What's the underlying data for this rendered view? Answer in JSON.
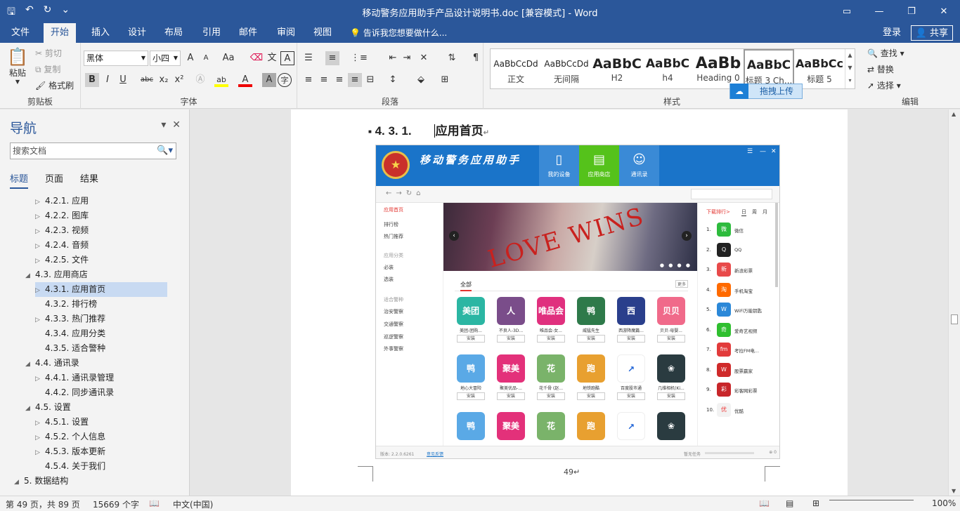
{
  "window": {
    "title": "移动警务应用助手产品设计说明书.doc [兼容模式] - Word",
    "quick_access": [
      "save-icon",
      "undo-icon",
      "redo-icon",
      "customize-icon"
    ],
    "controls": [
      "ribbon-display-icon",
      "minimize-icon",
      "restore-icon",
      "close-icon"
    ]
  },
  "tabs": [
    "文件",
    "开始",
    "插入",
    "设计",
    "布局",
    "引用",
    "邮件",
    "审阅",
    "视图"
  ],
  "active_tab": "开始",
  "tell_me": "告诉我您想要做什么...",
  "account": {
    "login": "登录",
    "share": "共享"
  },
  "ribbon": {
    "clipboard": {
      "label": "剪贴板",
      "paste": "粘贴",
      "cut": "剪切",
      "copy": "复制",
      "format_painter": "格式刷"
    },
    "font": {
      "label": "字体",
      "font_name": "黑体",
      "font_size": "小四",
      "change_case": "Aa",
      "bold": "B",
      "italic": "I",
      "underline": "U",
      "strike": "abc",
      "subscript": "x₂",
      "superscript": "x²",
      "highlight": "ab",
      "font_color": "A",
      "char_shade": "A",
      "enclose": "字",
      "wen": "文",
      "grow": "A",
      "shrink": "A"
    },
    "paragraph": {
      "label": "段落"
    },
    "styles": {
      "label": "样式",
      "items": [
        {
          "preview": "AaBbCcDd",
          "name": "正文"
        },
        {
          "preview": "AaBbCcDd",
          "name": "无间隔"
        },
        {
          "preview": "AaBbC",
          "name": "H2"
        },
        {
          "preview": "AaBbC",
          "name": "h4"
        },
        {
          "preview": "AaBb",
          "name": "Heading 0"
        },
        {
          "preview": "AaBbC",
          "name": "标题 3 Ch..."
        },
        {
          "preview": "AaBbCc",
          "name": "标题 5"
        }
      ],
      "upload": "拖拽上传"
    },
    "editing": {
      "label": "编辑",
      "find": "查找",
      "replace": "替换",
      "select": "选择"
    }
  },
  "nav": {
    "title": "导航",
    "search_placeholder": "搜索文档",
    "tabs": [
      "标题",
      "页面",
      "结果"
    ],
    "active_tab": "标题",
    "items": [
      {
        "label": "4.2.1. 应用",
        "expander": "collapsed",
        "selected": false
      },
      {
        "label": "4.2.2. 图库",
        "expander": "collapsed",
        "selected": false
      },
      {
        "label": "4.2.3. 视频",
        "expander": "collapsed",
        "selected": false
      },
      {
        "label": "4.2.4. 音频",
        "expander": "collapsed",
        "selected": false
      },
      {
        "label": "4.2.5. 文件",
        "expander": "collapsed",
        "selected": false
      },
      {
        "label": "4.3. 应用商店",
        "expander": "expanded",
        "selected": false
      },
      {
        "label": "4.3.1. 应用首页",
        "expander": "collapsed",
        "selected": true
      },
      {
        "label": "4.3.2. 排行榜",
        "expander": "none",
        "selected": false
      },
      {
        "label": "4.3.3. 热门推荐",
        "expander": "collapsed",
        "selected": false
      },
      {
        "label": "4.3.4. 应用分类",
        "expander": "none",
        "selected": false
      },
      {
        "label": "4.3.5. 适合警种",
        "expander": "none",
        "selected": false
      },
      {
        "label": "4.4. 通讯录",
        "expander": "expanded",
        "selected": false
      },
      {
        "label": "4.4.1. 通讯录管理",
        "expander": "collapsed",
        "selected": false
      },
      {
        "label": "4.4.2. 同步通讯录",
        "expander": "none",
        "selected": false
      },
      {
        "label": "4.5. 设置",
        "expander": "expanded",
        "selected": false
      },
      {
        "label": "4.5.1. 设置",
        "expander": "collapsed",
        "selected": false
      },
      {
        "label": "4.5.2. 个人信息",
        "expander": "collapsed",
        "selected": false
      },
      {
        "label": "4.5.3. 版本更新",
        "expander": "collapsed",
        "selected": false
      },
      {
        "label": "4.5.4. 关于我们",
        "expander": "none",
        "selected": false
      },
      {
        "label": "5. 数据结构",
        "expander": "expanded",
        "selected": false
      }
    ]
  },
  "doc": {
    "heading_number": "4. 3. 1.",
    "heading_text": "应用首页",
    "page_number": "49",
    "app": {
      "title": "移动警务应用助手",
      "header_tabs": [
        {
          "label": "我的设备",
          "icon": "device-icon",
          "color": "#3a8ad6"
        },
        {
          "label": "应用商店",
          "icon": "store-icon",
          "color": "#55c21b"
        },
        {
          "label": "通讯录",
          "icon": "contacts-icon",
          "color": "#3a8ad6"
        }
      ],
      "side_items": [
        {
          "label": "应用首页",
          "kind": "active"
        },
        {
          "label": "排行榜",
          "kind": "item"
        },
        {
          "label": "热门推荐",
          "kind": "item"
        },
        {
          "label": "应用分类",
          "kind": "cap"
        },
        {
          "label": "必装",
          "kind": "item"
        },
        {
          "label": "选装",
          "kind": "item"
        },
        {
          "label": "适合警种",
          "kind": "cap"
        },
        {
          "label": "治安警察",
          "kind": "item"
        },
        {
          "label": "交通警察",
          "kind": "item"
        },
        {
          "label": "巡逻警察",
          "kind": "item"
        },
        {
          "label": "外事警察",
          "kind": "item"
        }
      ],
      "banner_text": "LOVE WINS",
      "category": "全部",
      "more": "更多",
      "install": "安装",
      "apps_row1": [
        {
          "name": "美团-团购...",
          "glyph": "美团",
          "color": "#2bb6a3"
        },
        {
          "name": "不良人-3D...",
          "glyph": "人",
          "color": "#7a4d8a"
        },
        {
          "name": "唯品会-女...",
          "glyph": "唯品会",
          "color": "#e0307e"
        },
        {
          "name": "威猛先生",
          "glyph": "鸭",
          "color": "#2e7a4a"
        },
        {
          "name": "西游降魔篇...",
          "glyph": "西",
          "color": "#2a3f8c"
        },
        {
          "name": "贝贝-母婴...",
          "glyph": "贝贝",
          "color": "#f06a8a"
        }
      ],
      "apps_row2": [
        {
          "name": "地心大冒险",
          "glyph": "鸭",
          "color": "#5aa9e6"
        },
        {
          "name": "聚美优品-...",
          "glyph": "聚美",
          "color": "#e3317a"
        },
        {
          "name": "花千骨 (赵...",
          "glyph": "花",
          "color": "#7ab36a"
        },
        {
          "name": "地铁跑酷",
          "glyph": "跑",
          "color": "#e8a030"
        },
        {
          "name": "百度股市通",
          "glyph": "↗",
          "color": "#ffffff"
        },
        {
          "name": "几维相机(Ki...",
          "glyph": "❀",
          "color": "#2a3b40"
        }
      ],
      "apps_row3": [
        {
          "glyph": "鸭",
          "color": "#5aa9e6"
        },
        {
          "glyph": "聚美",
          "color": "#e3317a"
        },
        {
          "glyph": "花",
          "color": "#7ab36a"
        },
        {
          "glyph": "跑",
          "color": "#e8a030"
        },
        {
          "glyph": "↗",
          "color": "#ffffff"
        },
        {
          "glyph": "❀",
          "color": "#2a3b40"
        }
      ],
      "rank_header": "下载排行>",
      "rank_tabs": [
        "日",
        "周",
        "月"
      ],
      "rank": [
        {
          "no": "1.",
          "name": "微信",
          "glyph": "微",
          "color": "#2dbb3d"
        },
        {
          "no": "2.",
          "name": "QQ",
          "glyph": "Q",
          "color": "#222222"
        },
        {
          "no": "3.",
          "name": "新浪彩票",
          "glyph": "新",
          "color": "#e84a4a"
        },
        {
          "no": "4.",
          "name": "手机淘宝",
          "glyph": "淘",
          "color": "#ff6a00"
        },
        {
          "no": "5.",
          "name": "WiFi万能钥匙",
          "glyph": "W",
          "color": "#2b88d8"
        },
        {
          "no": "6.",
          "name": "爱奇艺视频",
          "glyph": "奇",
          "color": "#2fbf2f"
        },
        {
          "no": "7.",
          "name": "考拉FM电...",
          "glyph": "fm",
          "color": "#e23b3b"
        },
        {
          "no": "8.",
          "name": "股票赢家",
          "glyph": "W",
          "color": "#cf2a2a"
        },
        {
          "no": "9.",
          "name": "彩客网彩票",
          "glyph": "彩",
          "color": "#c8262a"
        },
        {
          "no": "10.",
          "name": "优酷",
          "glyph": "优",
          "color": "#f2f2f2"
        }
      ],
      "footer": {
        "version": "版本: 2.2.0.6261",
        "feedback": "意见反馈",
        "tasks": "暂无任务",
        "count": "0"
      }
    }
  },
  "status": {
    "page": "第 49 页，共 89 页",
    "words": "15669 个字",
    "lang": "中文(中国)",
    "zoom": "100%"
  },
  "colors": {
    "brand": "#2b579a"
  }
}
